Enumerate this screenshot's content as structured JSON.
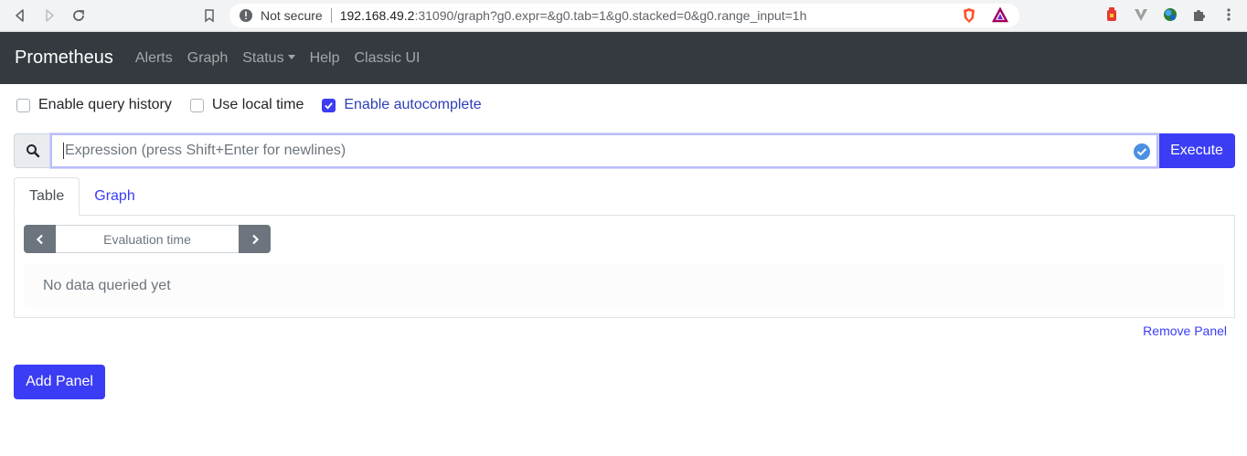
{
  "browser": {
    "security_label": "Not secure",
    "url_host": "192.168.49.2",
    "url_path": ":31090/graph?g0.expr=&g0.tab=1&g0.stacked=0&g0.range_input=1h"
  },
  "navbar": {
    "brand": "Prometheus",
    "links": [
      "Alerts",
      "Graph",
      "Status",
      "Help",
      "Classic UI"
    ]
  },
  "options": {
    "query_history": {
      "label": "Enable query history",
      "checked": false
    },
    "local_time": {
      "label": "Use local time",
      "checked": false
    },
    "autocomplete": {
      "label": "Enable autocomplete",
      "checked": true
    }
  },
  "expression": {
    "placeholder": "Expression (press Shift+Enter for newlines)",
    "execute_label": "Execute"
  },
  "panel": {
    "tabs": [
      "Table",
      "Graph"
    ],
    "active_tab": "Table",
    "eval_time_placeholder": "Evaluation time",
    "empty_message": "No data queried yet",
    "remove_label": "Remove Panel"
  },
  "add_panel_label": "Add Panel",
  "colors": {
    "primary": "#3b3df5",
    "navbar_bg": "#343a40"
  }
}
